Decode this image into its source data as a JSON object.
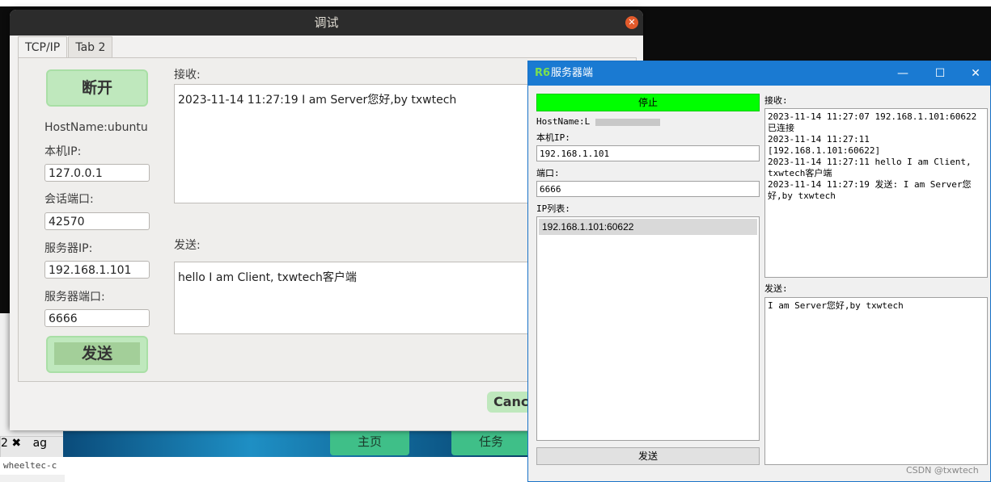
{
  "background": {
    "tab_label": "ag",
    "tab_close": "✖",
    "tab_num": "2",
    "terminal_text": "wheeltec-c",
    "taskbar_buttons": [
      "主页",
      "任务"
    ]
  },
  "ubuntu_dialog": {
    "title": "调试",
    "tabs": [
      "TCP/IP",
      "Tab 2"
    ],
    "disconnect_label": "断开",
    "hostname_label": "HostName:ubuntu",
    "local_ip_label": "本机IP:",
    "local_ip_value": "127.0.0.1",
    "session_port_label": "会话端口:",
    "session_port_value": "42570",
    "server_ip_label": "服务器IP:",
    "server_ip_value": "192.168.1.101",
    "server_port_label": "服务器端口:",
    "server_port_value": "6666",
    "send_button": "发送",
    "receive_label": "接收:",
    "receive_text": "2023-11-14 11:27:19 I am Server您好,by txwtech",
    "send_label": "发送:",
    "send_text": "hello I am Client, txwtech客户端",
    "cancel_button": "Canc"
  },
  "windows_dialog": {
    "title": "服务器端",
    "logo": "R6",
    "minimize": "—",
    "maximize": "☐",
    "close": "✕",
    "stop_button": "停止",
    "hostname_label": "HostName:L",
    "local_ip_label": "本机IP:",
    "local_ip_value": "192.168.1.101",
    "port_label": "端口:",
    "port_value": "6666",
    "ip_list_label": "IP列表:",
    "ip_list": [
      "192.168.1.101:60622"
    ],
    "send_button": "发送",
    "receive_label": "接收:",
    "receive_lines": [
      "2023-11-14 11:27:07 192.168.1.101:60622已连接",
      "2023-11-14 11:27:11 [192.168.1.101:60622]",
      "2023-11-14 11:27:11 hello I am Client, txwtech客户端",
      "2023-11-14 11:27:19 发送: I am Server您好,by txwtech"
    ],
    "send_label": "发送:",
    "send_text": "I am Server您好,by txwtech"
  },
  "watermark": "CSDN @txwtech",
  "colors": {
    "green_button": "#bfe8bd",
    "stop_button": "#00ff00",
    "win_titlebar": "#1a7ad2"
  }
}
